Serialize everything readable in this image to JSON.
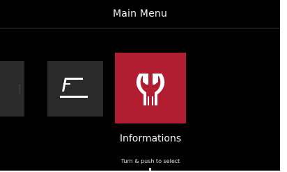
{
  "header": {
    "title": "Main Menu"
  },
  "menu": {
    "items": [
      {
        "icon": "unknown-partial-icon",
        "selected": false
      },
      {
        "icon": "welding-torch-icon",
        "selected": false
      },
      {
        "icon": "wrench-icon",
        "label": "Informations",
        "selected": true
      }
    ],
    "selected_label": "Informations"
  },
  "footer": {
    "hint": "Turn & push to select"
  },
  "colors": {
    "background": "#000000",
    "tile": "#2a2a2a",
    "selected_tile": "#b11e32",
    "text": "#f2f2f2"
  }
}
